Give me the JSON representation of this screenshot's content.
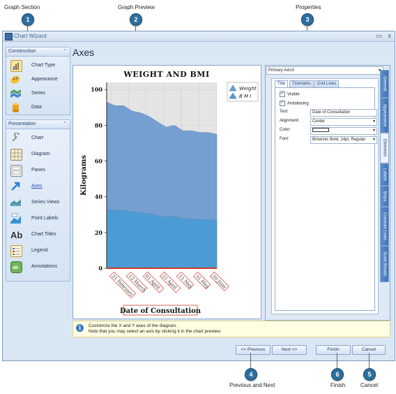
{
  "callouts": [
    {
      "number": "1",
      "label": "Graph Section"
    },
    {
      "number": "2",
      "label": "Graph Preview"
    },
    {
      "number": "3",
      "label": "Properties"
    },
    {
      "number": "4",
      "label": "Previous and Next"
    },
    {
      "number": "6",
      "label": "Finish"
    },
    {
      "number": "5",
      "label": "Cancel"
    }
  ],
  "window": {
    "title": "Chart Wizard",
    "restore_glyph": "▭",
    "close_glyph": "x"
  },
  "sidebar": {
    "construction": {
      "header": "Construction",
      "items": [
        {
          "label": "Chart Type",
          "icon": "bar-chart-icon",
          "color": "#d9a12a"
        },
        {
          "label": "Appearance",
          "icon": "palette-icon",
          "color": "#f2c12e"
        },
        {
          "label": "Series",
          "icon": "series-icon",
          "color": "#5aa36a"
        },
        {
          "label": "Data",
          "icon": "data-cylinder-icon",
          "color": "#e8a21d"
        }
      ]
    },
    "presentation": {
      "header": "Presentation",
      "items": [
        {
          "label": "Chart",
          "icon": "chart-wrench-icon",
          "color": "#c8cdd3"
        },
        {
          "label": "Diagram",
          "icon": "diagram-grid-icon",
          "color": "#d9c9a7"
        },
        {
          "label": "Panes",
          "icon": "panes-icon",
          "color": "#c9c9c9"
        },
        {
          "label": "Axes",
          "icon": "axes-arrow-icon",
          "color": "#2f7cd3",
          "active": true
        },
        {
          "label": "Series Views",
          "icon": "series-views-icon",
          "color": "#5fa0d6"
        },
        {
          "label": "Point Labels",
          "icon": "point-labels-icon",
          "color": "#3f8fd8"
        },
        {
          "label": "Chart Titles",
          "icon": "chart-titles-icon",
          "color": "#333333"
        },
        {
          "label": "Legend",
          "icon": "legend-icon",
          "color": "#e0b14a"
        },
        {
          "label": "Annotations",
          "icon": "annotations-icon",
          "color": "#6fb35a"
        }
      ]
    }
  },
  "main": {
    "page_title": "Axes",
    "hint_line1": "Customize the X and Y axes of the diagram.",
    "hint_line2": "Note that you may select an axis by clicking it in the chart preview."
  },
  "properties": {
    "axis_selector": "Primary AxisX",
    "tabs": [
      "Title",
      "Tickmarks",
      "Grid Lines"
    ],
    "visible_label": "Visible",
    "antialiasing_label": "Antialiasing",
    "text_label": "Text:",
    "text_value": "Date of Consultation",
    "alignment_label": "Alignment:",
    "alignment_value": "Center",
    "color_label": "Color:",
    "font_label": "Font:",
    "font_value": "Britannic Bold, 14pt, Regular",
    "side_tabs": [
      "General",
      "Appearance",
      "Elements",
      "Labels",
      "Strips",
      "Constant Lines",
      "Scale Breaks"
    ]
  },
  "buttons": {
    "previous": "<< Previous",
    "next": "Next >>",
    "finish": "Finish",
    "cancel": "Cancel"
  },
  "chart_data": {
    "type": "area",
    "title": "WEIGHT AND BMI",
    "xlabel": "Date of Consultation",
    "ylabel": "Kilograms",
    "x_tick_labels": [
      "21 February",
      "12 March",
      "01 April",
      "21 April",
      "11 May",
      "31 May",
      "20 June"
    ],
    "y_ticks": [
      0,
      20,
      40,
      60,
      80,
      100
    ],
    "ylim": [
      0,
      104
    ],
    "x": [
      0,
      1,
      2,
      3,
      4,
      5,
      6,
      7,
      8,
      9,
      10,
      11,
      12,
      13
    ],
    "series": [
      {
        "name": "Weight",
        "color": "#6f9ccf",
        "values": [
          93,
          91,
          91,
          88,
          87,
          85,
          82,
          79,
          80,
          77,
          77,
          76,
          76,
          75
        ]
      },
      {
        "name": "B M I",
        "color": "#4d9bd4",
        "values": [
          33,
          32.5,
          32.5,
          31.5,
          31,
          30.5,
          29.5,
          28.5,
          29,
          28,
          27.5,
          27.5,
          27,
          27
        ]
      }
    ],
    "legend": "top-right",
    "grid": true,
    "accent": "#d13a2a"
  }
}
